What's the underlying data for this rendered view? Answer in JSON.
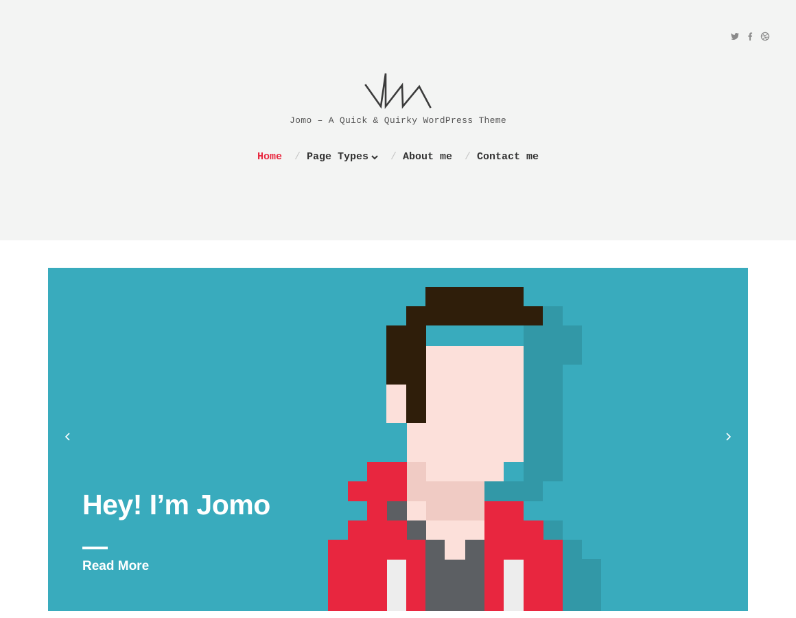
{
  "site": {
    "tagline": "Jomo – A Quick & Quirky WordPress Theme",
    "logo_icon": "jomo-logo-icon"
  },
  "social": [
    {
      "name": "twitter",
      "icon": "twitter-icon"
    },
    {
      "name": "facebook",
      "icon": "facebook-icon"
    },
    {
      "name": "dribbble",
      "icon": "dribbble-icon"
    }
  ],
  "nav": {
    "items": [
      {
        "label": "Home",
        "active": true
      },
      {
        "label": "Page Types",
        "has_dropdown": true
      },
      {
        "label": "About me"
      },
      {
        "label": "Contact me"
      }
    ],
    "separator": "/"
  },
  "hero": {
    "title": "Hey! I’m Jomo",
    "link_label": "Read More",
    "prev_icon": "chevron-left-icon",
    "next_icon": "chevron-right-icon",
    "illustration": "pixel-avatar"
  },
  "colors": {
    "accent": "#e8283f",
    "header_bg": "#f3f4f3",
    "hero_bg": "#39abbd",
    "text_dark": "#333333",
    "pixel_shadow": "#3298a7",
    "pixel_hair": "#2f1e0a",
    "pixel_skin": "#fce0da",
    "pixel_skin_shade": "#f0cbc4",
    "pixel_jacket": "#e8263f",
    "pixel_shirt": "#5c5f63",
    "pixel_highlight": "#ededed"
  }
}
